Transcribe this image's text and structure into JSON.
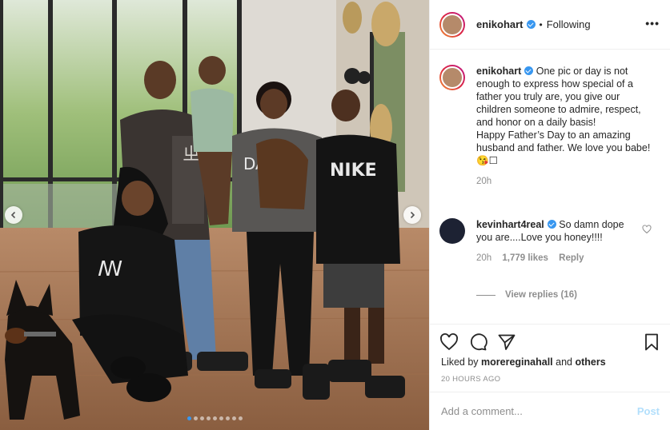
{
  "post": {
    "author": "enikohart",
    "follow_status": "Following",
    "bullet": "•",
    "more_label": "•••"
  },
  "caption": {
    "username": "enikohart",
    "text": "One pic or day is not enough to express how special of a father you truly are, you give our children someone to admire, respect, and honor on a daily basis!",
    "text2": "Happy Father’s Day to an amazing husband and father. We love you babe! 😘☐",
    "time": "20h"
  },
  "comment": {
    "username": "kevinhart4real",
    "text": "So damn dope you are....Love you honey!!!!",
    "time": "20h",
    "likes": "1,779 likes",
    "reply": "Reply",
    "view_replies": "View replies (16)"
  },
  "actions": {
    "liked_by_prefix": "Liked by ",
    "liked_by_user": "morereginahall",
    "liked_by_suffix": " and ",
    "liked_by_others": "others",
    "timestamp": "20 HOURS AGO"
  },
  "add_comment": {
    "placeholder": "Add a comment...",
    "post_label": "Post"
  },
  "carousel": {
    "total": 9,
    "active_index": 0
  },
  "colors": {
    "accent": "#3897f0",
    "muted": "#8e8e8e",
    "post_disabled": "#b2dffc"
  }
}
